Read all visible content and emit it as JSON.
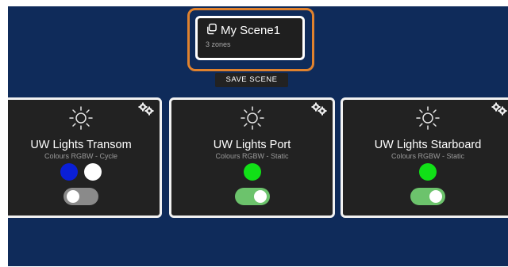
{
  "scene": {
    "title": "My Scene1",
    "subtitle": "3 zones",
    "icon": "copy-icon",
    "highlight_color": "#e0822e"
  },
  "save_button_label": "SAVE SCENE",
  "zones": [
    {
      "name": "UW Lights Transom",
      "mode": "Colours RGBW - Cycle",
      "colors": [
        "#0a1fd6",
        "#ffffff"
      ],
      "enabled": false
    },
    {
      "name": "UW Lights Port",
      "mode": "Colours RGBW - Static",
      "colors": [
        "#11e017"
      ],
      "enabled": true
    },
    {
      "name": "UW Lights Starboard",
      "mode": "Colours RGBW - Static",
      "colors": [
        "#11e017"
      ],
      "enabled": true
    }
  ],
  "icons": {
    "zone_icon": "sun-icon",
    "settings_icon": "gears-icon"
  },
  "colors": {
    "background": "#0f2b5a",
    "card": "#222222",
    "toggle_on": "#6cc36c",
    "toggle_off": "#8a8a8a"
  }
}
